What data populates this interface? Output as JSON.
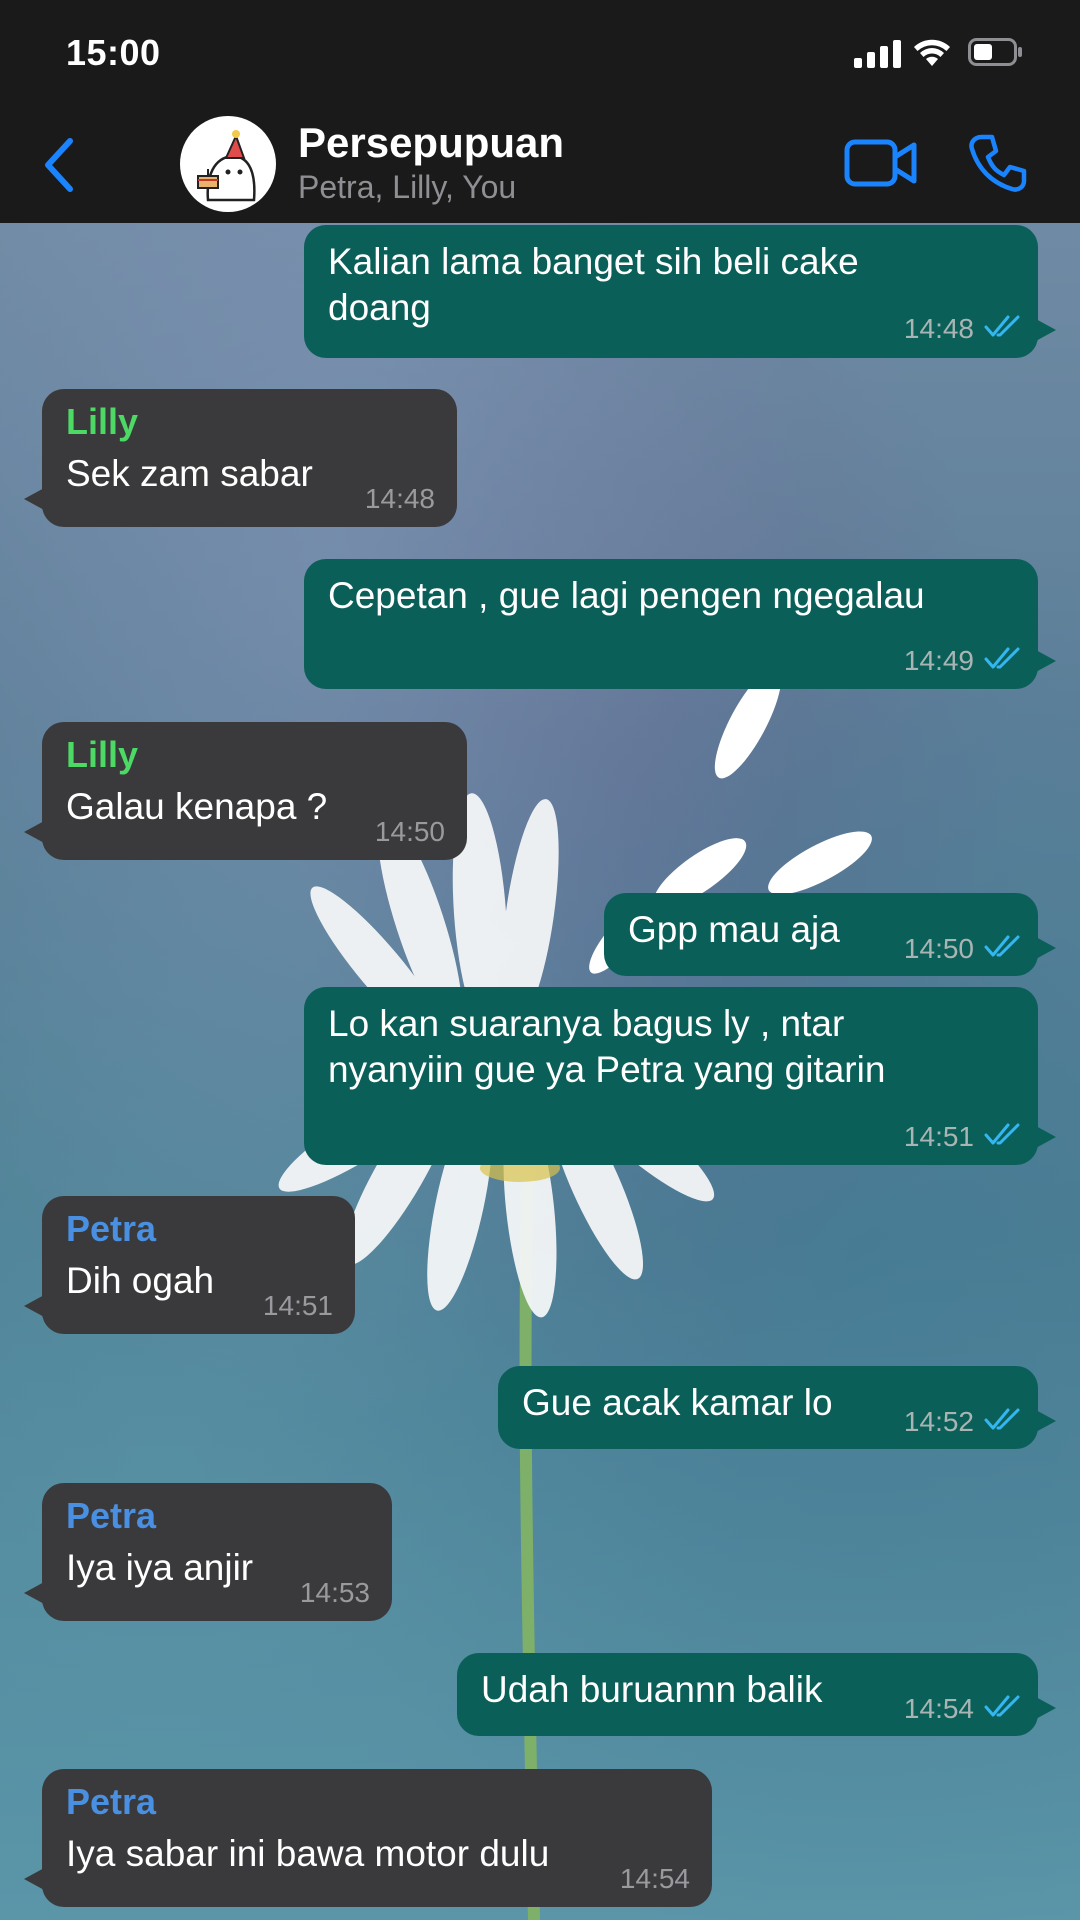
{
  "status_bar": {
    "time": "15:00"
  },
  "header": {
    "title": "Persepupuan",
    "members": "Petra, Lilly, You",
    "accent_color": "#1a84ff"
  },
  "messages": [
    {
      "direction": "out",
      "text": "Kalian lama banget sih beli cake\ndoang",
      "time": "14:48",
      "read": true
    },
    {
      "direction": "in",
      "sender": "Lilly",
      "sender_color": "#4cd964",
      "text": "Sek zam sabar",
      "time": "14:48"
    },
    {
      "direction": "out",
      "text": "Cepetan , gue lagi pengen ngegalau",
      "time": "14:49",
      "read": true
    },
    {
      "direction": "in",
      "sender": "Lilly",
      "sender_color": "#4cd964",
      "text": "Galau kenapa ?",
      "time": "14:50"
    },
    {
      "direction": "out",
      "text": "Gpp mau aja",
      "time": "14:50",
      "read": true
    },
    {
      "direction": "out",
      "text": "Lo kan suaranya bagus ly , ntar\nnyanyiin gue ya Petra yang gitarin",
      "time": "14:51",
      "read": true
    },
    {
      "direction": "in",
      "sender": "Petra",
      "sender_color": "#4a90e2",
      "text": "Dih ogah",
      "time": "14:51"
    },
    {
      "direction": "out",
      "text": "Gue acak kamar lo",
      "time": "14:52",
      "read": true
    },
    {
      "direction": "in",
      "sender": "Petra",
      "sender_color": "#4a90e2",
      "text": "Iya iya anjir",
      "time": "14:53"
    },
    {
      "direction": "out",
      "text": "Udah buruannn balik",
      "time": "14:54",
      "read": true
    },
    {
      "direction": "in",
      "sender": "Petra",
      "sender_color": "#4a90e2",
      "text": "Iya sabar ini bawa motor dulu",
      "time": "14:54"
    }
  ]
}
